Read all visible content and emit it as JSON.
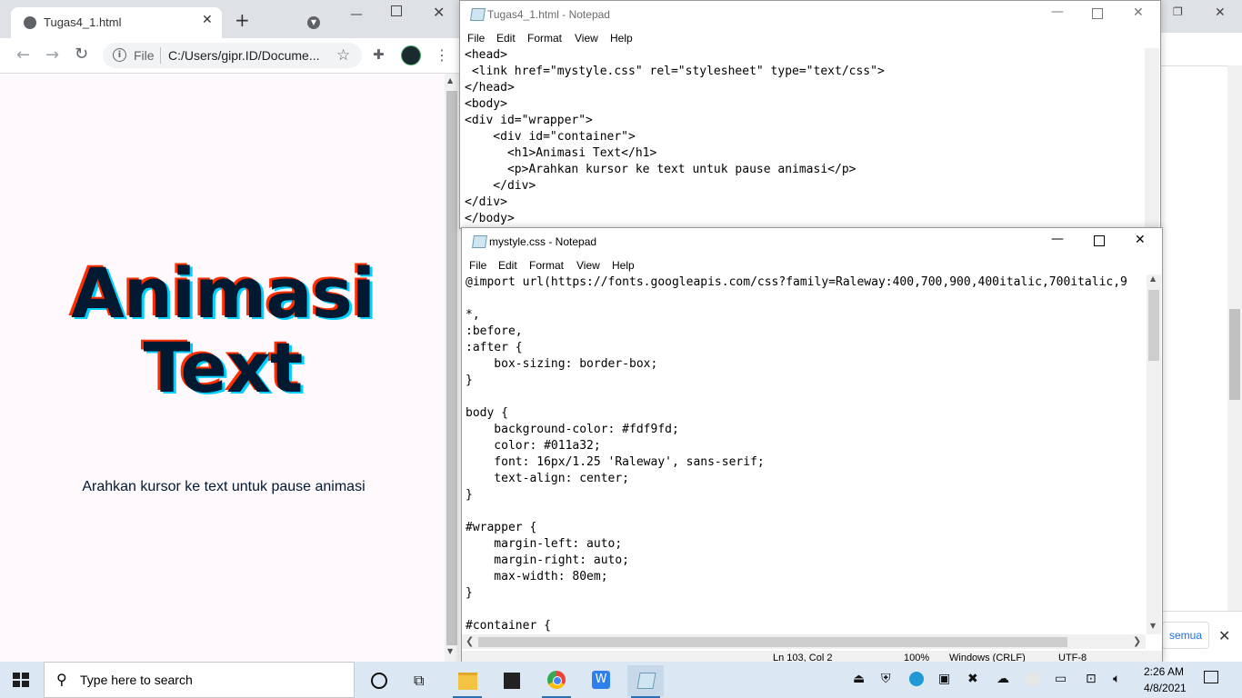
{
  "chrome": {
    "tab_title": "Tugas4_1.html",
    "omnibox_scheme": "File",
    "omnibox_url": "C:/Users/gipr.ID/Docume...",
    "page": {
      "heading": "Animasi Text",
      "paragraph": "Arahkan kursor ke text untuk pause animasi",
      "background": "#fdf9fd",
      "text_color": "#011a32"
    }
  },
  "background_window": {
    "chip_label": "semua"
  },
  "notepad_html": {
    "title": "Tugas4_1.html - Notepad",
    "menu": [
      "File",
      "Edit",
      "Format",
      "View",
      "Help"
    ],
    "code": "<head>\n <link href=\"mystyle.css\" rel=\"stylesheet\" type=\"text/css\">\n</head>\n<body>\n<div id=\"wrapper\">\n    <div id=\"container\">\n      <h1>Animasi Text</h1>\n      <p>Arahkan kursor ke text untuk pause animasi</p>\n    </div>\n</div>\n</body>"
  },
  "notepad_css": {
    "title": "mystyle.css - Notepad",
    "menu": [
      "File",
      "Edit",
      "Format",
      "View",
      "Help"
    ],
    "code": "@import url(https://fonts.googleapis.com/css?family=Raleway:400,700,900,400italic,700italic,9\n\n*,\n:before,\n:after {\n    box-sizing: border-box;\n}\n\nbody {\n    background-color: #fdf9fd;\n    color: #011a32;\n    font: 16px/1.25 'Raleway', sans-serif;\n    text-align: center;\n}\n\n#wrapper {\n    margin-left: auto;\n    margin-right: auto;\n    max-width: 80em;\n}\n\n#container {",
    "status": {
      "position": "Ln 103, Col 2",
      "zoom": "100%",
      "line_ending": "Windows (CRLF)",
      "encoding": "UTF-8"
    }
  },
  "taskbar": {
    "search_placeholder": "Type here to search",
    "time": "2:26 AM",
    "date": "4/8/2021"
  }
}
